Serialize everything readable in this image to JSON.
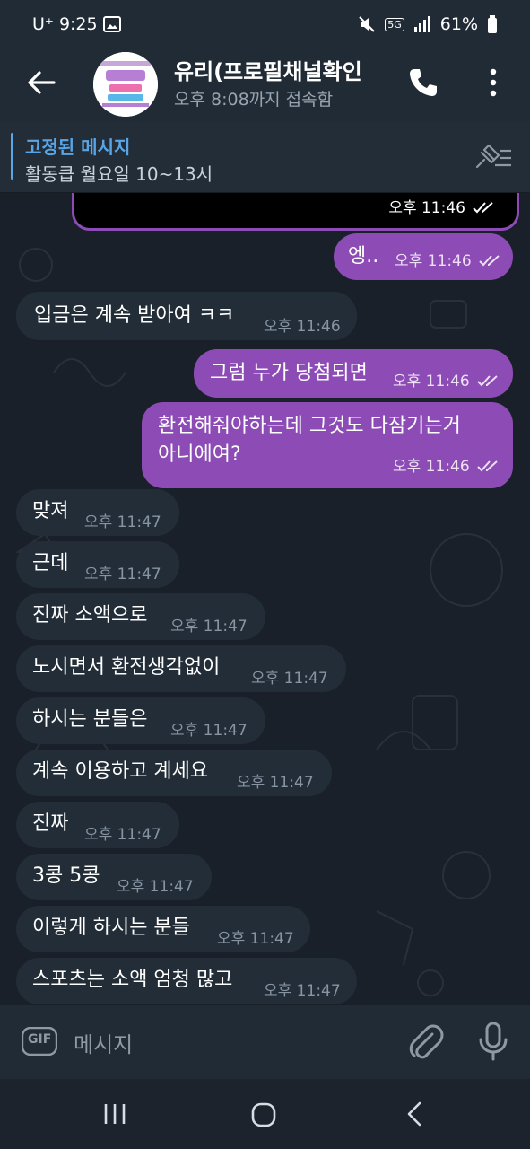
{
  "status_bar": {
    "carrier": "U⁺",
    "time": "9:25",
    "network": "5G",
    "battery": "61%"
  },
  "header": {
    "title": "유리(프로필채널확인",
    "subtitle": "오후 8:08까지 접속함"
  },
  "pinned": {
    "title": "고정된 메시지",
    "text": "활동큽 월요일 10~13시"
  },
  "messages": [
    {
      "dir": "out",
      "text": "",
      "time": "오후 11:46",
      "read": true
    },
    {
      "dir": "out",
      "text": "엥..",
      "time": "오후 11:46",
      "read": true
    },
    {
      "dir": "in",
      "text": "입금은 계속 받아여 ㅋㅋ",
      "time": "오후 11:46"
    },
    {
      "dir": "out",
      "text": "그럼 누가 당첨되면",
      "time": "오후 11:46",
      "read": true
    },
    {
      "dir": "out",
      "text": "환전해줘야하는데 그것도 다잠기는거",
      "text2": "아니에여?",
      "time": "오후 11:46",
      "read": true
    },
    {
      "dir": "in",
      "text": "맞져",
      "time": "오후 11:47"
    },
    {
      "dir": "in",
      "text": "근데",
      "time": "오후 11:47"
    },
    {
      "dir": "in",
      "text": "진짜 소액으로",
      "time": "오후 11:47"
    },
    {
      "dir": "in",
      "text": "노시면서 환전생각없이",
      "time": "오후 11:47"
    },
    {
      "dir": "in",
      "text": "하시는 분들은",
      "time": "오후 11:47"
    },
    {
      "dir": "in",
      "text": "계속 이용하고 계세요",
      "time": "오후 11:47"
    },
    {
      "dir": "in",
      "text": "진짜",
      "time": "오후 11:47"
    },
    {
      "dir": "in",
      "text": "3콩 5콩",
      "time": "오후 11:47"
    },
    {
      "dir": "in",
      "text": "이렇게 하시는 분들",
      "time": "오후 11:47"
    },
    {
      "dir": "in",
      "text": "스포츠는 소액 엄청 많고",
      "time": "오후 11:47"
    }
  ],
  "composer": {
    "gif_label": "GIF",
    "placeholder": "메시지"
  },
  "colors": {
    "outgoing_bubble": "#8c4bb5",
    "incoming_bubble": "#222d38",
    "accent": "#5aa5e6"
  }
}
